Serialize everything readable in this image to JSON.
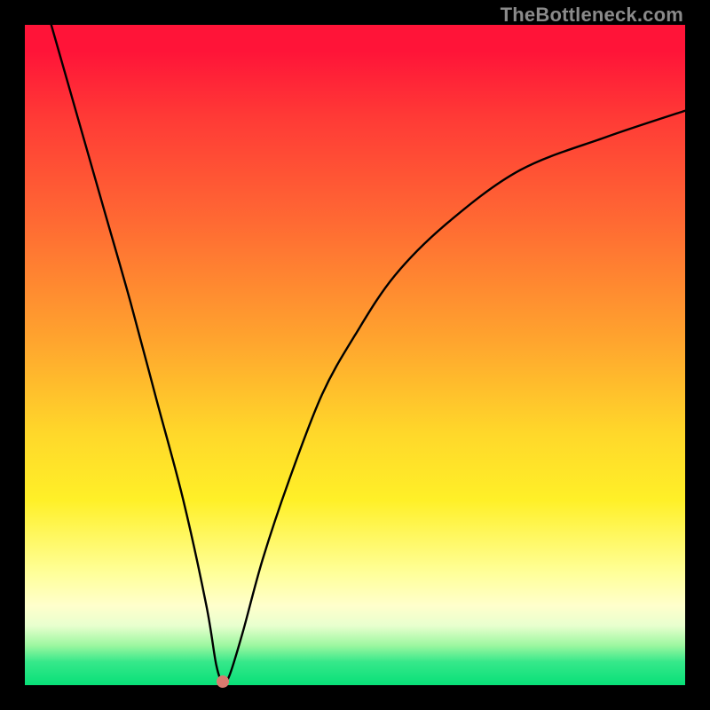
{
  "watermark": "TheBottleneck.com",
  "chart_data": {
    "type": "line",
    "title": "",
    "xlabel": "",
    "ylabel": "",
    "xlim": [
      0,
      100
    ],
    "ylim": [
      0,
      100
    ],
    "series": [
      {
        "name": "bottleneck-curve",
        "x": [
          4,
          8,
          12,
          16,
          20,
          24,
          27.5,
          29,
          30,
          31,
          33,
          36,
          40,
          45,
          50,
          56,
          64,
          75,
          88,
          100
        ],
        "y": [
          100,
          86,
          72,
          58,
          43,
          28,
          12,
          3,
          0.5,
          1.5,
          8,
          19,
          31,
          44,
          53,
          62,
          70,
          78,
          83,
          87
        ]
      }
    ],
    "annotations": [
      {
        "name": "min-point-dot",
        "x": 30,
        "y": 0.5
      }
    ],
    "background_gradient": {
      "orientation": "vertical",
      "stops": [
        {
          "pos": 0.0,
          "color": "#ff1438"
        },
        {
          "pos": 0.3,
          "color": "#ff6a33"
        },
        {
          "pos": 0.62,
          "color": "#ffd82a"
        },
        {
          "pos": 0.88,
          "color": "#ffffcc"
        },
        {
          "pos": 1.0,
          "color": "#08e078"
        }
      ]
    }
  }
}
